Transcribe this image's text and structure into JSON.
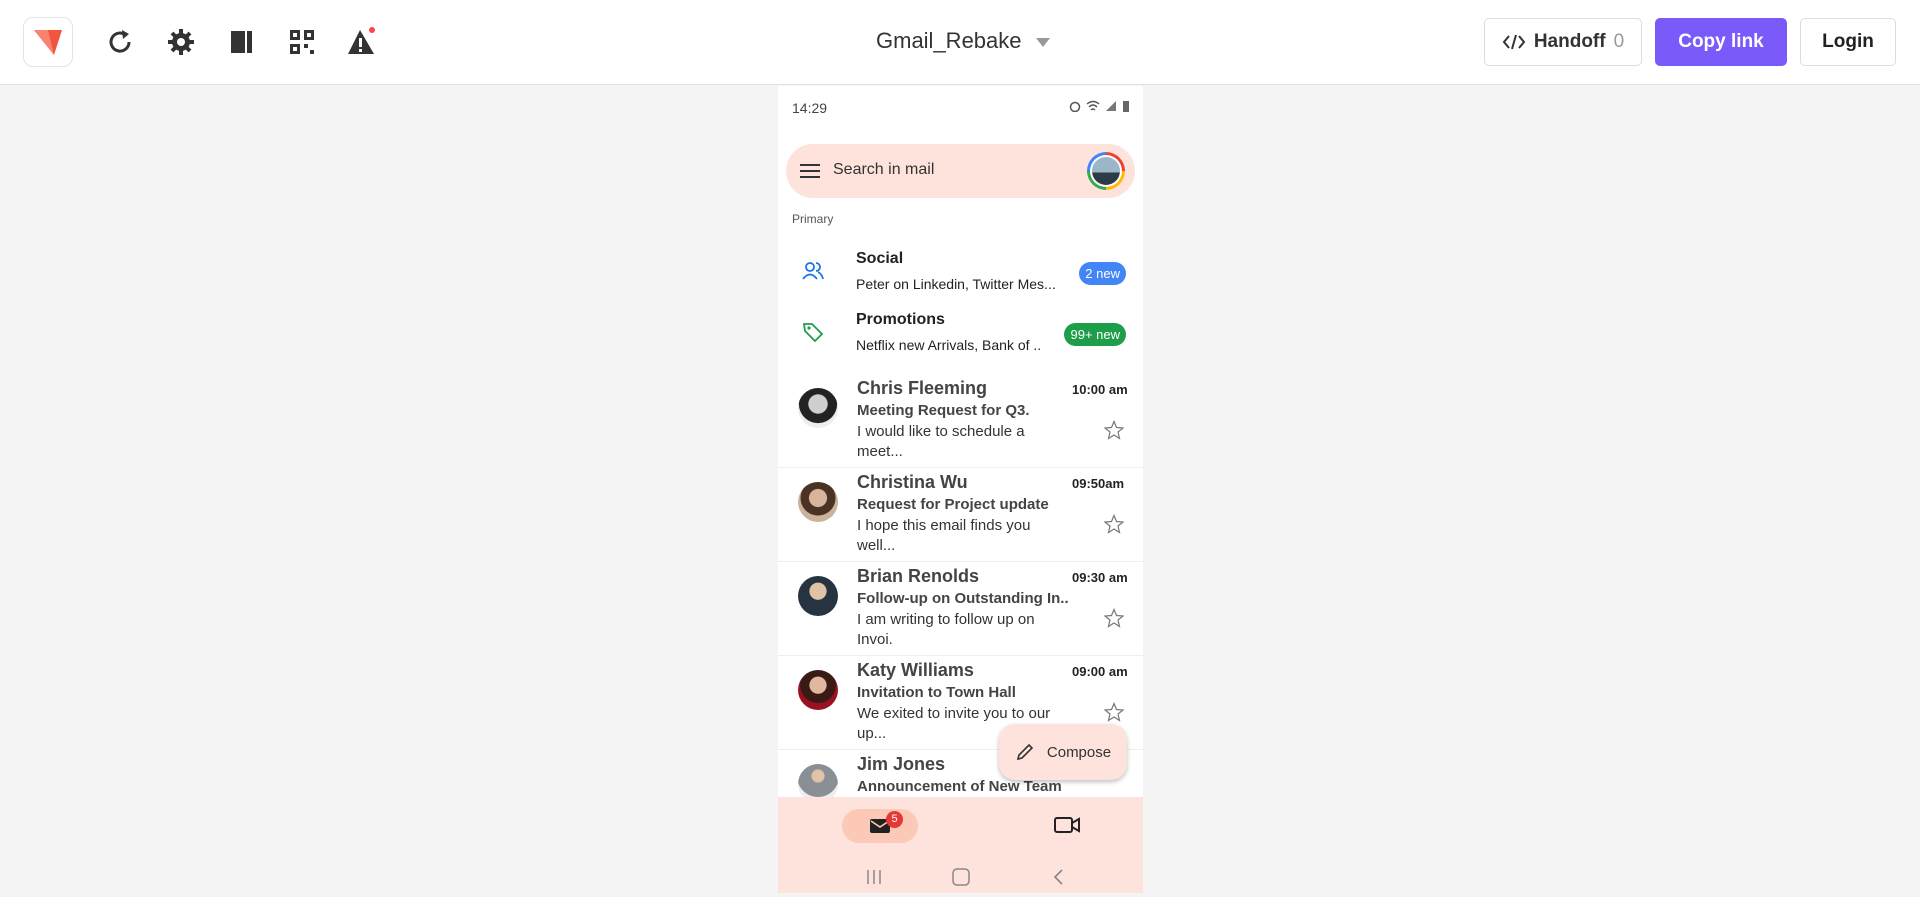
{
  "toolbar": {
    "project_name": "Gmail_Rebake",
    "handoff_label": "Handoff",
    "handoff_count": "0",
    "copy_link_label": "Copy link",
    "login_label": "Login",
    "accent_color": "#7a5af8"
  },
  "phone": {
    "status_time": "14:29",
    "search_placeholder": "Search in mail",
    "section_label": "Primary",
    "categories": [
      {
        "title": "Social",
        "subtitle": "Peter on Linkedin, Twitter Mes...",
        "badge": "2 new",
        "badge_color": "#4285f4",
        "icon": "people-icon"
      },
      {
        "title": "Promotions",
        "subtitle": "Netflix new Arrivals, Bank of ..",
        "badge": "99+ new",
        "badge_color": "#1e9e4a",
        "icon": "tag-icon"
      }
    ],
    "mails": [
      {
        "sender": "Chris Fleeming",
        "subject": "Meeting Request for Q3.",
        "snippet": "I would like to schedule a meet...",
        "time": "10:00 am"
      },
      {
        "sender": "Christina Wu",
        "subject": "Request for Project update",
        "snippet": "I hope this email finds you well...",
        "time": "09:50am"
      },
      {
        "sender": "Brian Renolds",
        "subject": "Follow-up on Outstanding In..",
        "snippet": "I am writing to follow up on Invoi.",
        "time": "09:30 am"
      },
      {
        "sender": "Katy Williams",
        "subject": "Invitation to Town Hall",
        "snippet": "We exited to invite you to our up...",
        "time": "09:00 am"
      },
      {
        "sender": "Jim Jones",
        "subject": "Announcement of New Team",
        "snippet": "",
        "time": ""
      }
    ],
    "compose_label": "Compose",
    "mail_badge": "5"
  }
}
